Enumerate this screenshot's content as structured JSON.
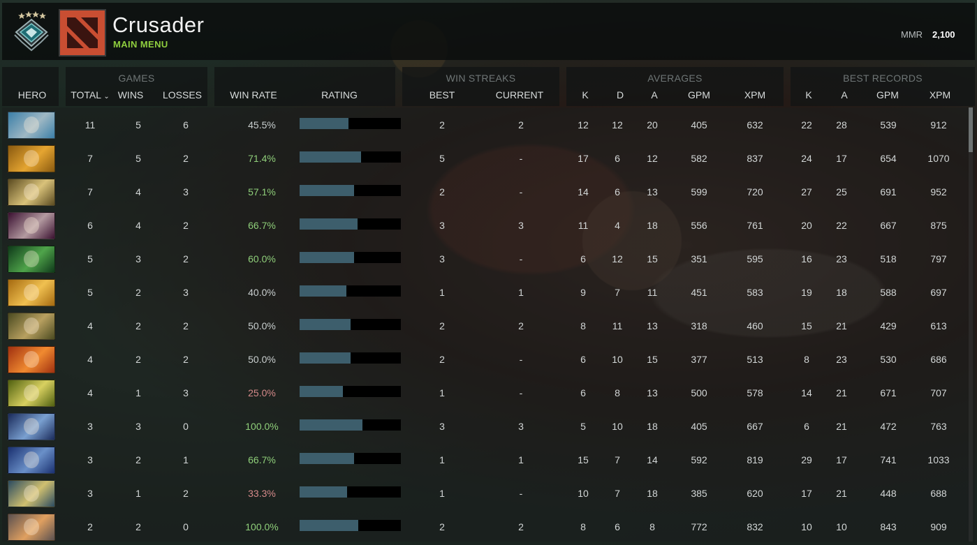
{
  "header": {
    "player_name": "Crusader",
    "subtitle": "MAIN MENU",
    "mmr_label": "MMR",
    "mmr_value": "2,100",
    "rank_icon": "rank-medal-icon",
    "logo_icon": "dota-logo-icon"
  },
  "columns": {
    "hero": "HERO",
    "games_group": "GAMES",
    "total": "TOTAL",
    "wins": "WINS",
    "losses": "LOSSES",
    "win_rate": "WIN RATE",
    "rating": "RATING",
    "streaks_group": "WIN STREAKS",
    "best": "BEST",
    "current": "CURRENT",
    "averages_group": "AVERAGES",
    "avg_k": "K",
    "avg_d": "D",
    "avg_a": "A",
    "avg_gpm": "GPM",
    "avg_xpm": "XPM",
    "records_group": "BEST RECORDS",
    "rec_k": "K",
    "rec_a": "A",
    "rec_gpm": "GPM",
    "rec_xpm": "XPM",
    "sort_indicator": "chevron-down-icon"
  },
  "colors": {
    "winrate_high": "#8fcf7a",
    "winrate_low": "#d58a8a",
    "winrate_mid": "#c9cfcf",
    "rating_fill": "#3d5e6c",
    "accent_green": "#8fce3e"
  },
  "rows": [
    {
      "total": "11",
      "wins": "5",
      "losses": "6",
      "win_rate": "45.5%",
      "rating": 0.48,
      "best": "2",
      "current": "2",
      "k": "12",
      "d": "12",
      "a": "20",
      "gpm": "405",
      "xpm": "632",
      "rk": "22",
      "ra": "28",
      "rgpm": "539",
      "rxpm": "912",
      "tone": "mid",
      "c1": "#3b7fa8",
      "c2": "#9fb8c4"
    },
    {
      "total": "7",
      "wins": "5",
      "losses": "2",
      "win_rate": "71.4%",
      "rating": 0.61,
      "best": "5",
      "current": "-",
      "k": "17",
      "d": "6",
      "a": "12",
      "gpm": "582",
      "xpm": "837",
      "rk": "24",
      "ra": "17",
      "rgpm": "654",
      "rxpm": "1070",
      "tone": "high",
      "c1": "#8a5a10",
      "c2": "#e5a531"
    },
    {
      "total": "7",
      "wins": "4",
      "losses": "3",
      "win_rate": "57.1%",
      "rating": 0.54,
      "best": "2",
      "current": "-",
      "k": "14",
      "d": "6",
      "a": "13",
      "gpm": "599",
      "xpm": "720",
      "rk": "27",
      "ra": "25",
      "rgpm": "691",
      "rxpm": "952",
      "tone": "high",
      "c1": "#5a4a20",
      "c2": "#d9c27a"
    },
    {
      "total": "6",
      "wins": "4",
      "losses": "2",
      "win_rate": "66.7%",
      "rating": 0.57,
      "best": "3",
      "current": "3",
      "k": "11",
      "d": "4",
      "a": "18",
      "gpm": "556",
      "xpm": "761",
      "rk": "20",
      "ra": "22",
      "rgpm": "667",
      "rxpm": "875",
      "tone": "high",
      "c1": "#3a1030",
      "c2": "#b39aa0"
    },
    {
      "total": "5",
      "wins": "3",
      "losses": "2",
      "win_rate": "60.0%",
      "rating": 0.54,
      "best": "3",
      "current": "-",
      "k": "6",
      "d": "12",
      "a": "15",
      "gpm": "351",
      "xpm": "595",
      "rk": "16",
      "ra": "23",
      "rgpm": "518",
      "rxpm": "797",
      "tone": "high",
      "c1": "#0f3a1a",
      "c2": "#4fa44a"
    },
    {
      "total": "5",
      "wins": "2",
      "losses": "3",
      "win_rate": "40.0%",
      "rating": 0.46,
      "best": "1",
      "current": "1",
      "k": "9",
      "d": "7",
      "a": "11",
      "gpm": "451",
      "xpm": "583",
      "rk": "19",
      "ra": "18",
      "rgpm": "588",
      "rxpm": "697",
      "tone": "mid",
      "c1": "#a56a10",
      "c2": "#f0c050"
    },
    {
      "total": "4",
      "wins": "2",
      "losses": "2",
      "win_rate": "50.0%",
      "rating": 0.5,
      "best": "2",
      "current": "2",
      "k": "8",
      "d": "11",
      "a": "13",
      "gpm": "318",
      "xpm": "460",
      "rk": "15",
      "ra": "21",
      "rgpm": "429",
      "rxpm": "613",
      "tone": "mid",
      "c1": "#4a4a20",
      "c2": "#b8a060"
    },
    {
      "total": "4",
      "wins": "2",
      "losses": "2",
      "win_rate": "50.0%",
      "rating": 0.5,
      "best": "2",
      "current": "-",
      "k": "6",
      "d": "10",
      "a": "15",
      "gpm": "377",
      "xpm": "513",
      "rk": "8",
      "ra": "23",
      "rgpm": "530",
      "rxpm": "686",
      "tone": "mid",
      "c1": "#a03010",
      "c2": "#f08a30"
    },
    {
      "total": "4",
      "wins": "1",
      "losses": "3",
      "win_rate": "25.0%",
      "rating": 0.43,
      "best": "1",
      "current": "-",
      "k": "6",
      "d": "8",
      "a": "13",
      "gpm": "500",
      "xpm": "578",
      "rk": "14",
      "ra": "21",
      "rgpm": "671",
      "rxpm": "707",
      "tone": "low",
      "c1": "#506010",
      "c2": "#d8d060"
    },
    {
      "total": "3",
      "wins": "3",
      "losses": "0",
      "win_rate": "100.0%",
      "rating": 0.62,
      "best": "3",
      "current": "3",
      "k": "5",
      "d": "10",
      "a": "18",
      "gpm": "405",
      "xpm": "667",
      "rk": "6",
      "ra": "21",
      "rgpm": "472",
      "rxpm": "763",
      "tone": "high",
      "c1": "#1a2a5a",
      "c2": "#7aa0d0"
    },
    {
      "total": "3",
      "wins": "2",
      "losses": "1",
      "win_rate": "66.7%",
      "rating": 0.54,
      "best": "1",
      "current": "1",
      "k": "15",
      "d": "7",
      "a": "14",
      "gpm": "592",
      "xpm": "819",
      "rk": "29",
      "ra": "17",
      "rgpm": "741",
      "rxpm": "1033",
      "tone": "high",
      "c1": "#1a3070",
      "c2": "#6a90c8"
    },
    {
      "total": "3",
      "wins": "1",
      "losses": "2",
      "win_rate": "33.3%",
      "rating": 0.47,
      "best": "1",
      "current": "-",
      "k": "10",
      "d": "7",
      "a": "18",
      "gpm": "385",
      "xpm": "620",
      "rk": "17",
      "ra": "21",
      "rgpm": "448",
      "rxpm": "688",
      "tone": "low",
      "c1": "#2a4a60",
      "c2": "#d0c070"
    },
    {
      "total": "2",
      "wins": "2",
      "losses": "0",
      "win_rate": "100.0%",
      "rating": 0.58,
      "best": "2",
      "current": "2",
      "k": "8",
      "d": "6",
      "a": "8",
      "gpm": "772",
      "xpm": "832",
      "rk": "10",
      "ra": "10",
      "rgpm": "843",
      "rxpm": "909",
      "tone": "high",
      "c1": "#5a5050",
      "c2": "#e0a060"
    }
  ]
}
